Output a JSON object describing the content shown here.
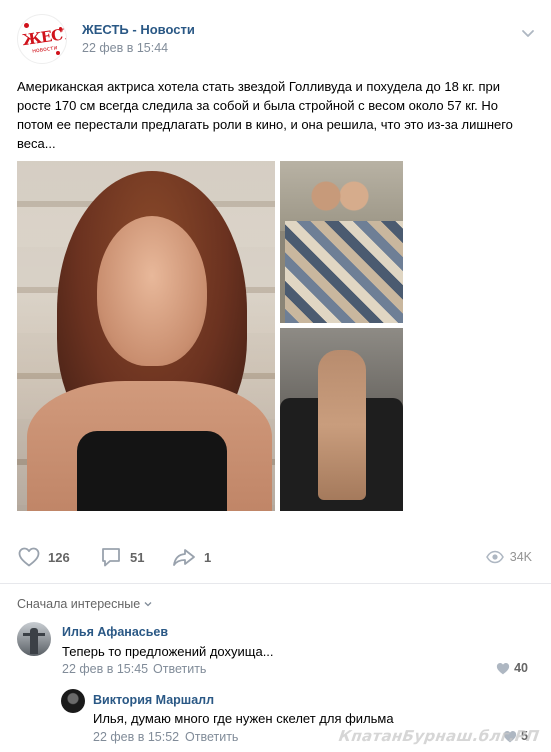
{
  "post": {
    "group_name": "ЖЕСТЬ - Новости",
    "group_logo_text": "ЖЕСТЬ",
    "group_logo_sub": "новости",
    "date": "22 фев в 15:44",
    "text": "Американская актриса хотела стать звездой Голливуда и похудела до 18 кг. при росте 170 см всегда следила за собой и была стройной с весом около 57 кг. Но потом ее перестали предлагать роли в кино, и она решила, что это из-за лишнего веса...",
    "photos": [
      {
        "icon": "portrait-photo"
      },
      {
        "icon": "hospital-bed-photo"
      },
      {
        "icon": "thin-woman-photo"
      }
    ]
  },
  "actions": {
    "likes": "126",
    "comments": "51",
    "shares": "1",
    "views": "34K"
  },
  "comments_section": {
    "sort_label": "Сначала интересные"
  },
  "comments": [
    {
      "author": "Илья Афанасьев",
      "text": "Теперь то предложений дохуища...",
      "date": "22 фев в 15:45",
      "reply_label": "Ответить",
      "likes": "40"
    },
    {
      "author": "Виктория Маршалл",
      "text": "Илья, думаю много где нужен скелет для фильма",
      "date": "22 фев в 15:52",
      "reply_label": "Ответить",
      "likes": "5"
    }
  ],
  "watermark": "КпатанБурнаш.блг.РП",
  "colors": {
    "link": "#2a5885",
    "meta": "#818c99",
    "brand_red": "#d0121b"
  }
}
